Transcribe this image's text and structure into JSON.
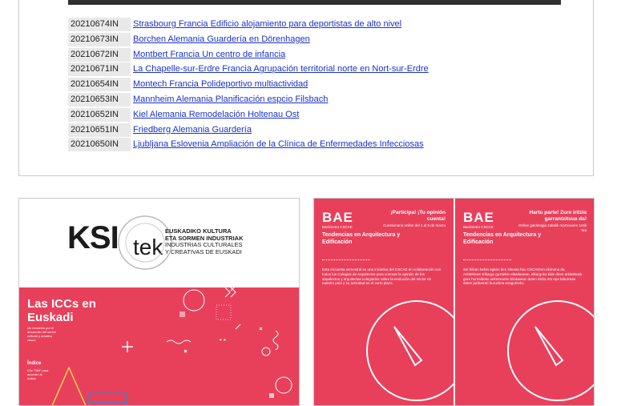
{
  "list": {
    "rows": [
      {
        "code": "20210674IN",
        "text": "Strasbourg Francia Edificio alojamiento para deportistas de alto nivel "
      },
      {
        "code": "20210673IN",
        "text": "Borchen Alemania Guardería en Dörenhagen "
      },
      {
        "code": "20210672IN",
        "text": "Montbert Francia Un centro de infancia "
      },
      {
        "code": "20210671IN",
        "text": "La Chapelle-sur-Erdre Francia Agrupación territorial norte en Nort-sur-Erdre "
      },
      {
        "code": "20210654IN",
        "text": "Montech Francia Polideportivo multiactividad"
      },
      {
        "code": "20210653IN",
        "text": "Mannheim Alemania Planificación espcio Filsbach"
      },
      {
        "code": "20210652IN",
        "text": "Kiel Alemania Remodelación Holtenau Ost"
      },
      {
        "code": "20210651IN",
        "text": "Friedberg Alemania Guardería "
      },
      {
        "code": "20210650IN",
        "text": "Ljubljana Eslovenia Ampliación de la Clínica de Enfermedades Infecciosas"
      }
    ]
  },
  "ksi": {
    "logo_word": "KSI",
    "logo_tek": "tek",
    "line1": "EUSKADIKO KULTURA",
    "line2": "ETA SORMEN INDUSTRIAK",
    "line3": "INDUSTRIAS CULTURALES",
    "line4": "Y CREATIVAS DE EUSKADI",
    "title": "Las ICCs en Euskadi",
    "small": "Un recorrido por el desarrollo del sector cultural y creativo vasco",
    "index": "Índice",
    "index_sub": "Clic \"Stilt\" para acceder al índice"
  },
  "bae": [
    {
      "logo": "BAE",
      "logo_sub": "Barómetro CSCAE",
      "head": "¡Participa! ¡Tu opinión cuenta!",
      "note": "Cuestionario online del 1 al 9 de marzo",
      "title": "Tendencias en Arquitectura y Edificación",
      "body": "Esta encuesta semestral es una iniciativa del CSCAE en colaboración con todos los Colegios de Arquitectos para conocer la opinión de los arquitectos y arquitectas colegiados sobre la evolución del sector en nuestro país y su actividad en el corto plazo."
    },
    {
      "logo": "BAE",
      "logo_sub": "Barómetro CSCAE",
      "head": "Hartu parte! Zure iritzia garrantzitsua da!",
      "note": "Online galdetegia zabalik martxoaren 1etik 9ra",
      "title": "Tendencias en Arquitectura y Edificación",
      "body": "Sei hilean behin egiten den inkesta hau CSCAEren ekimena da, Arkitektoen Elkargo guztiekin elkarlanean, elkargoko kide diren arkitektoek gure herrialdeko sektorearen bilakaeraz duten iritzia eta epe laburrean duten jarduerari buruzkoa ezagutzeko."
    }
  ],
  "colors": {
    "accent": "#e8405b",
    "link": "#1a33c8",
    "code_bg": "#e9e9e9"
  }
}
